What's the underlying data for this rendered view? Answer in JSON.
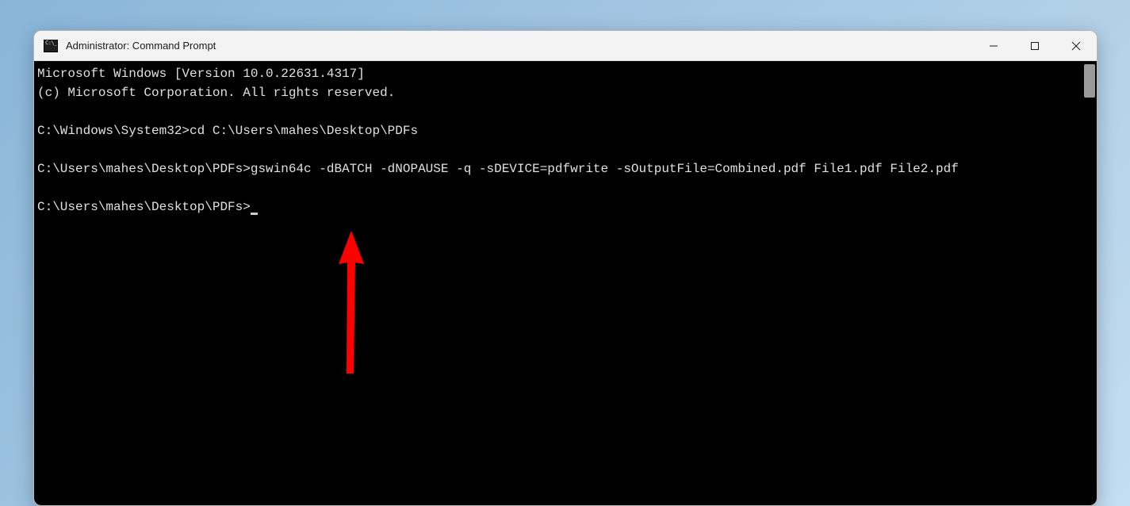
{
  "window": {
    "title": "Administrator: Command Prompt"
  },
  "terminal": {
    "line0": "Microsoft Windows [Version 10.0.22631.4317]",
    "line1": "(c) Microsoft Corporation. All rights reserved.",
    "blank1": "",
    "line2_prompt": "C:\\Windows\\System32>",
    "line2_cmd": "cd C:\\Users\\mahes\\Desktop\\PDFs",
    "blank2": "",
    "line3_prompt": "C:\\Users\\mahes\\Desktop\\PDFs>",
    "line3_cmd": "gswin64c -dBATCH -dNOPAUSE -q -sDEVICE=pdfwrite -sOutputFile=Combined.pdf File1.pdf File2.pdf",
    "blank3": "",
    "line4_prompt": "C:\\Users\\mahes\\Desktop\\PDFs>"
  },
  "annotation": {
    "arrow_color": "#ff0000"
  }
}
